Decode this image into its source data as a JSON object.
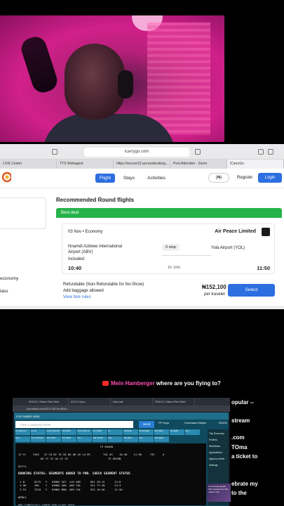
{
  "browser": {
    "url": "icarrygo.com",
    "tabs": [
      "LIVE Center",
      "TTS Webagent",
      "https://secure10.accessbooking...",
      "Post Attendee - Zoom",
      "iCarryGo"
    ],
    "nav": [
      "Flight",
      "Stays",
      "Activities"
    ],
    "currency": "(₦)",
    "register": "Register",
    "login": "Login"
  },
  "sidebar": {
    "economy": "economy",
    "class": "lass"
  },
  "results": {
    "title": "Recommended Round flights",
    "badge": "Best deal",
    "date": "03 Nov",
    "cabin": "Economy",
    "airline": "Air Peace Limited",
    "from": "Nnamdi Azikiwe International Airport (ABV)",
    "stops": "0 stop",
    "to": "Yola Airport (YOL)",
    "included": "Included:",
    "depart": "10:40",
    "duration": "1h 10m",
    "arrive": "11:50",
    "refund": "Refundable (Non-Refundable for No-Show)",
    "baggage": "Add baggage allowed",
    "fare_rules": "View fare rules",
    "price": "₦152,100",
    "per": "per traveler",
    "select": "Select"
  },
  "chat": {
    "name": "Mein Hamberger",
    "message": "where are you flying to?"
  },
  "bleed": [
    "opular --",
    "stream",
    ".com",
    "TOma",
    "a ticket to",
    "ebrate my",
    "to the"
  ],
  "terminal": {
    "tabs": [
      "ROUG | Sabre Red Web",
      "ATA & Sync",
      "New tab",
      "ROUG | Sabre Red Web"
    ],
    "url": "srw.sabre.com/23.9.15/?in=8f4a...",
    "header": "FOS SABRE WEB",
    "command_placeholder": "TYPE COMMAND HERE",
    "send": "Send",
    "pf_keys": "PF Keys",
    "helper": "Command Helper",
    "rough": "ROUG",
    "keys": [
      "F1 SIGN IN",
      "F2 JS",
      "F3 RS SHOW",
      "F4 PNRS",
      "F5 GL BOOK",
      "F6 CURR",
      "F7 ...",
      "F8 AVAIL",
      "F9 SCHED",
      "F10 SELL",
      "F11 EMR",
      "F12 ...",
      "F13 ...",
      "F14 CANCEL",
      "F15 AVAIL",
      "F16 SEAT",
      "F17 ...",
      "F18 CURR",
      "F19 ...",
      "F20 RFS",
      "F21 ...",
      "F22 SEAT"
    ],
    "lines": [
      "                                                   TS KOSON",
      "",
      "12 FL    7426   JI CO BI YA SA BA AH AV LA MC        YOL #1    10:40    11:50     733     0",
      "              WZ TC VI AS VC ZZ                         TS KOSON",
      "",
      "0IY*‡",
      "",
      "BOOKING STATUS: SEGMENTS ADDED TO PNR. CHECK SEGMENT STATUS",
      "",
      " 1 W      K275   Y   03NOV SAT  LOS ABV      HK1 20:15      23:0",
      " 2 HK     268    Y   03NOV SUN  ABV YOL      SS1 77:30      23:3",
      " 3 P4     7518   Y   03NOV MON  ABV YOL      SS2 10:40      11:50",
      "",
      "WPNC‡",
      "",
      "NNC-CONFIG/ALL FARTS FOR CLASS USED."
    ],
    "side": [
      "Trip Summary",
      "Profiles",
      "Workflows",
      "Applications",
      "",
      "",
      "",
      "Agency Admin",
      "Settings"
    ]
  },
  "ad": "Connecting people with experiences that matter most"
}
